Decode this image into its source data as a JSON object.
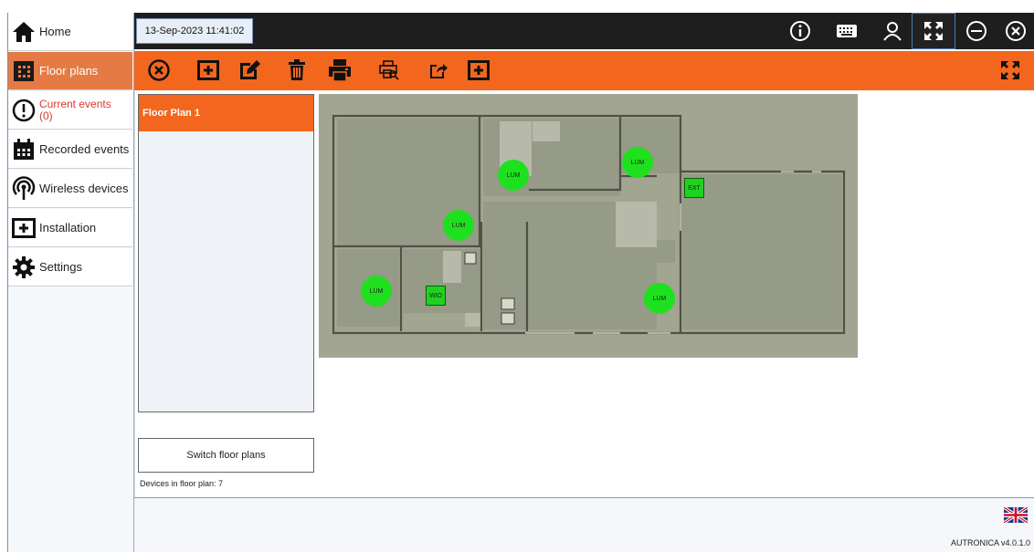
{
  "nav": {
    "items": [
      {
        "label": "Home",
        "icon": "home-icon"
      },
      {
        "label": "Floor plans",
        "icon": "floor-plan-icon",
        "active": true
      },
      {
        "label": "Current events",
        "count": "(0)",
        "icon": "exclamation-icon"
      },
      {
        "label": "Recorded events",
        "icon": "calendar-icon"
      },
      {
        "label": "Wireless devices",
        "icon": "wireless-icon"
      },
      {
        "label": "Installation",
        "icon": "installation-icon"
      },
      {
        "label": "Settings",
        "icon": "gear-icon"
      }
    ]
  },
  "header": {
    "datetime": "13-Sep-2023 11:41:02",
    "icons": [
      "info-icon",
      "keyboard-icon",
      "user-icon",
      "fullscreen-icon",
      "minimize-icon",
      "close-icon"
    ]
  },
  "toolbar": {
    "icons": [
      "cancel-icon",
      "add-icon",
      "edit-icon",
      "delete-icon",
      "print-icon",
      "print-preview-icon",
      "export-icon",
      "add-device-icon",
      "expand-icon"
    ]
  },
  "floorplans": {
    "items": [
      "Floor Plan 1"
    ],
    "switch_label": "Switch floor plans",
    "devices_text": "Devices in floor plan: 7"
  },
  "devices": [
    {
      "label": "LUM",
      "type": "lum"
    },
    {
      "label": "LUM",
      "type": "lum"
    },
    {
      "label": "EXT",
      "type": "box"
    },
    {
      "label": "LUM",
      "type": "lum"
    },
    {
      "label": "LUM",
      "type": "lum"
    },
    {
      "label": "WIO",
      "type": "box"
    },
    {
      "label": "LUM",
      "type": "lum"
    }
  ],
  "footer": {
    "version": "AUTRONICA v4.0.1.0",
    "language_icon": "uk-flag-icon"
  },
  "colors": {
    "accent": "#f2661e",
    "active_nav": "#e57a45",
    "topbar": "#1e1e1e",
    "device": "#1fe01f",
    "alert_text": "#d63a2e"
  }
}
